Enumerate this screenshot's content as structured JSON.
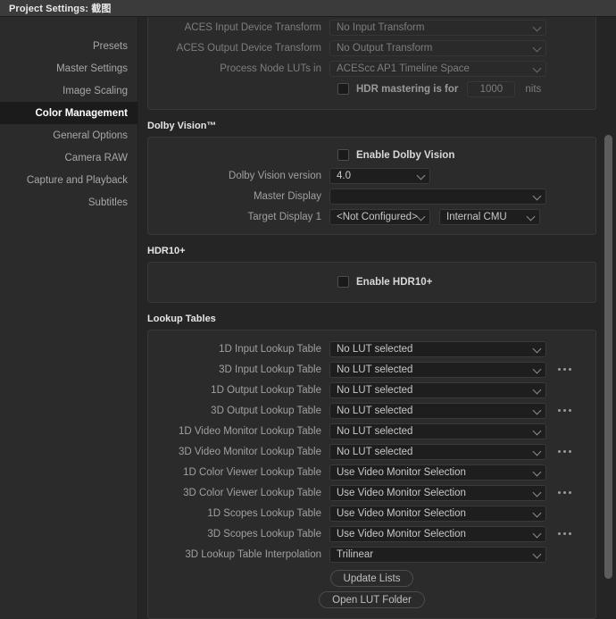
{
  "window": {
    "title": "Project Settings: 截图"
  },
  "sidebar": {
    "items": [
      {
        "label": "Presets",
        "selected": false
      },
      {
        "label": "Master Settings",
        "selected": false
      },
      {
        "label": "Image Scaling",
        "selected": false
      },
      {
        "label": "Color Management",
        "selected": true
      },
      {
        "label": "General Options",
        "selected": false
      },
      {
        "label": "Camera RAW",
        "selected": false
      },
      {
        "label": "Capture and Playback",
        "selected": false
      },
      {
        "label": "Subtitles",
        "selected": false
      }
    ]
  },
  "aces": {
    "rows": [
      {
        "label": "ACES Input Device Transform",
        "value": "No Input Transform"
      },
      {
        "label": "ACES Output Device Transform",
        "value": "No Output Transform"
      },
      {
        "label": "Process Node LUTs in",
        "value": "ACEScc AP1 Timeline Space"
      }
    ],
    "hdr_mastering_label": "HDR mastering is for",
    "hdr_mastering_value": "1000",
    "hdr_mastering_unit": "nits"
  },
  "dolby_vision": {
    "section_title": "Dolby Vision™",
    "enable_label": "Enable Dolby Vision",
    "version_label": "Dolby Vision version",
    "version_value": "4.0",
    "master_display_label": "Master Display",
    "master_display_value": "",
    "target_display_label": "Target Display 1",
    "target_display_value": "<Not Configured>",
    "target_cmu_value": "Internal CMU"
  },
  "hdr10plus": {
    "section_title": "HDR10+",
    "enable_label": "Enable HDR10+"
  },
  "lookup_tables": {
    "section_title": "Lookup Tables",
    "rows": [
      {
        "label": "1D Input Lookup Table",
        "value": "No LUT selected",
        "browse": false
      },
      {
        "label": "3D Input Lookup Table",
        "value": "No LUT selected",
        "browse": true
      },
      {
        "label": "1D Output Lookup Table",
        "value": "No LUT selected",
        "browse": false
      },
      {
        "label": "3D Output Lookup Table",
        "value": "No LUT selected",
        "browse": true
      },
      {
        "label": "1D Video Monitor Lookup Table",
        "value": "No LUT selected",
        "browse": false
      },
      {
        "label": "3D Video Monitor Lookup Table",
        "value": "No LUT selected",
        "browse": true
      },
      {
        "label": "1D Color Viewer Lookup Table",
        "value": "Use Video Monitor Selection",
        "browse": false
      },
      {
        "label": "3D Color Viewer Lookup Table",
        "value": "Use Video Monitor Selection",
        "browse": true
      },
      {
        "label": "1D Scopes Lookup Table",
        "value": "Use Video Monitor Selection",
        "browse": false
      },
      {
        "label": "3D Scopes Lookup Table",
        "value": "Use Video Monitor Selection",
        "browse": true
      },
      {
        "label": "3D Lookup Table Interpolation",
        "value": "Trilinear",
        "browse": false
      }
    ],
    "update_lists_label": "Update Lists",
    "open_lut_folder_label": "Open LUT Folder"
  },
  "colors": {
    "window_bg": "#252525",
    "panel_bg": "#2b2b2b",
    "titlebar_bg": "#3b3b3b",
    "selected_item_bg": "#1b1b1b",
    "field_bg": "#1e1e1e",
    "text": "#c8c8c8",
    "label": "#a0a0a0",
    "scrollbar_thumb": "#5c5c5c"
  }
}
